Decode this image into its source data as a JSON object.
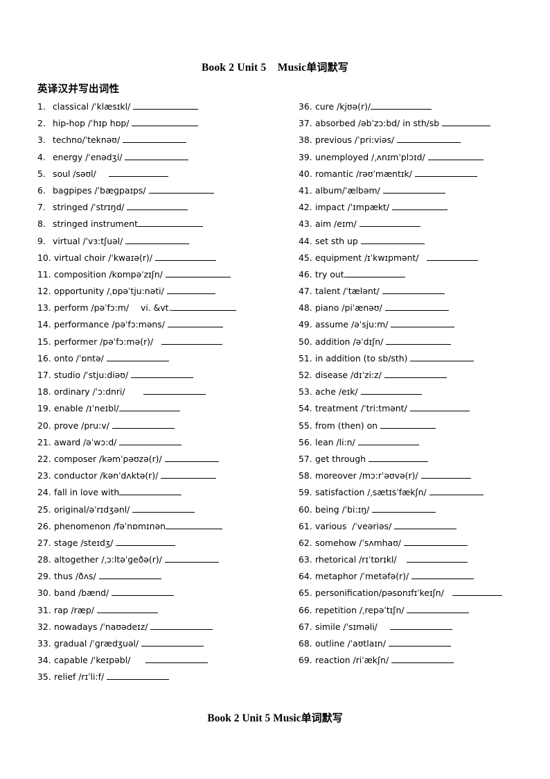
{
  "document": {
    "title_en": "Book 2 Unit 5    Music",
    "title_cn": "单词默写",
    "section_heading": "英译汉并写出词性",
    "footer_en": "Book 2 Unit 5 Music",
    "footer_cn": "单词默写"
  },
  "columns": {
    "left": [
      {
        "num": "1.",
        "term": "classical /ˈklæsɪkl/ ",
        "gap": 0,
        "blank": 94
      },
      {
        "num": "2.",
        "term": "hip-hop /ˈhɪp hɒp/ ",
        "gap": 0,
        "blank": 96
      },
      {
        "num": "3.",
        "term": "techno/ˈteknəʊ/ ",
        "gap": 0,
        "blank": 92
      },
      {
        "num": "4.",
        "term": "energy /ˈenədʒi/ ",
        "gap": 0,
        "blank": 92
      },
      {
        "num": "5.",
        "term": "soul /səʊl/ ",
        "gap": 14,
        "blank": 86
      },
      {
        "num": "6.",
        "term": "bagpipes /ˈbæɡpaɪps/ ",
        "gap": 0,
        "blank": 94
      },
      {
        "num": "7.",
        "term": "stringed /ˈstrɪŋd/ ",
        "gap": 0,
        "blank": 88
      },
      {
        "num": "8.",
        "term": "stringed instrument",
        "gap": 0,
        "blank": 94
      },
      {
        "num": "9.",
        "term": "virtual /ˈvɜ:tʃuəl/ ",
        "gap": 0,
        "blank": 92
      },
      {
        "num": "10.",
        "term": "virtual choir /ˈkwaɪə(r)/ ",
        "gap": 0,
        "blank": 88
      },
      {
        "num": "11.",
        "term": "composition /kɒmpəˈzɪʃn/ ",
        "gap": 0,
        "blank": 94
      },
      {
        "num": "12.",
        "term": "opportunity /ˌɒpəˈtju:nəti/ ",
        "gap": 0,
        "blank": 70
      },
      {
        "num": "13.",
        "term": "perform /pəˈfɔ:m/ ",
        "gap": 13,
        "blank": 0,
        "tail": "vi. &vt.",
        "tail_blank": 94
      },
      {
        "num": "14.",
        "term": "performance /pəˈfɔ:məns/ ",
        "gap": 0,
        "blank": 80
      },
      {
        "num": "15.",
        "term": "performer /pəˈfɔ:mə(r)/ ",
        "gap": 8,
        "blank": 88
      },
      {
        "num": "16.",
        "term": "onto /ˈɒntə/ ",
        "gap": 0,
        "blank": 90
      },
      {
        "num": "17.",
        "term": "studio /ˈstju:diəʊ/ ",
        "gap": 0,
        "blank": 90
      },
      {
        "num": "18.",
        "term": "ordinary /ˈɔ:dnri/ ",
        "gap": 22,
        "blank": 90
      },
      {
        "num": "19.",
        "term": "enable /ɪˈneɪbl/",
        "gap": 0,
        "blank": 88
      },
      {
        "num": "20.",
        "term": "prove /pru:v/ ",
        "gap": 0,
        "blank": 90
      },
      {
        "num": "21.",
        "term": "award /əˈwɔ:d/ ",
        "gap": 0,
        "blank": 90
      },
      {
        "num": "22.",
        "term": "composer /kəmˈpəʊzə(r)/ ",
        "gap": 0,
        "blank": 78
      },
      {
        "num": "23.",
        "term": "conductor /kənˈdʌktə(r)/ ",
        "gap": 0,
        "blank": 80
      },
      {
        "num": "24.",
        "term": "fall in love with",
        "gap": 0,
        "blank": 90
      },
      {
        "num": "25.",
        "term": "original/əˈrɪdʒənl/ ",
        "gap": 0,
        "blank": 90
      },
      {
        "num": "26.",
        "term": "phenomenon /fəˈnɒmɪnən",
        "gap": 0,
        "blank": 82
      },
      {
        "num": "27.",
        "term": "stage /steɪdʒ/ ",
        "gap": 0,
        "blank": 86
      },
      {
        "num": "28.",
        "term": "altogether /ˌɔ:ltəˈɡeðə(r)/ ",
        "gap": 0,
        "blank": 78
      },
      {
        "num": "29.",
        "term": "thus /ðʌs/ ",
        "gap": 0,
        "blank": 90
      },
      {
        "num": "30.",
        "term": "band /bænd/ ",
        "gap": 0,
        "blank": 90
      },
      {
        "num": "31.",
        "term": "rap /ræp/ ",
        "gap": 0,
        "blank": 88
      },
      {
        "num": "32.",
        "term": "nowadays /ˈnaʊədeɪz/ ",
        "gap": 0,
        "blank": 90
      },
      {
        "num": "33.",
        "term": "gradual /ˈɡrædʒuəl/ ",
        "gap": 0,
        "blank": 90
      },
      {
        "num": "34.",
        "term": "capable /ˈkeɪpəbl/ ",
        "gap": 18,
        "blank": 90
      },
      {
        "num": "35.",
        "term": "relief /rɪˈli:f/ ",
        "gap": 0,
        "blank": 90
      }
    ],
    "right": [
      {
        "num": "36.",
        "term": "cure /kjʊə(r)/",
        "gap": 0,
        "blank": 88
      },
      {
        "num": "37.",
        "term": "absorbed /əbˈzɔ:bd/ in sth/sb ",
        "gap": 0,
        "blank": 70
      },
      {
        "num": "38.",
        "term": "previous /ˈpri:viəs/ ",
        "gap": 0,
        "blank": 92
      },
      {
        "num": "39.",
        "term": "unemployed /ˌʌnɪmˈplɔɪd/ ",
        "gap": 0,
        "blank": 80
      },
      {
        "num": "40.",
        "term": "romantic /rəʊˈmæntɪk/ ",
        "gap": 0,
        "blank": 90
      },
      {
        "num": "41.",
        "term": "album/ˈælbəm/ ",
        "gap": 0,
        "blank": 90
      },
      {
        "num": "42.",
        "term": "impact /ˈɪmpækt/ ",
        "gap": 0,
        "blank": 80
      },
      {
        "num": "43.",
        "term": "aim /eɪm/ ",
        "gap": 0,
        "blank": 88
      },
      {
        "num": "44.",
        "term": "set sth up ",
        "gap": 0,
        "blank": 92
      },
      {
        "num": "45.",
        "term": "equipment /ɪˈkwɪpmənt/ ",
        "gap": 8,
        "blank": 74
      },
      {
        "num": "46.",
        "term": "try out",
        "gap": 0,
        "blank": 88
      },
      {
        "num": "47.",
        "term": "talent /ˈtælənt/ ",
        "gap": 0,
        "blank": 90
      },
      {
        "num": "48.",
        "term": "piano /piˈænəʊ/ ",
        "gap": 0,
        "blank": 92
      },
      {
        "num": "49.",
        "term": "assume /əˈsju:m/ ",
        "gap": 0,
        "blank": 92
      },
      {
        "num": "50.",
        "term": "addition /əˈdɪʃn/ ",
        "gap": 0,
        "blank": 94
      },
      {
        "num": "51.",
        "term": "in addition (to sb/sth) ",
        "gap": 0,
        "blank": 92
      },
      {
        "num": "52.",
        "term": "disease /dɪˈzi:z/ ",
        "gap": 0,
        "blank": 90
      },
      {
        "num": "53.",
        "term": "ache /eɪk/ ",
        "gap": 0,
        "blank": 88
      },
      {
        "num": "54.",
        "term": "treatment /ˈtri:tmənt/ ",
        "gap": 0,
        "blank": 86
      },
      {
        "num": "55.",
        "term": "from (then) on ",
        "gap": 0,
        "blank": 80
      },
      {
        "num": "56.",
        "term": "lean /li:n/ ",
        "gap": 0,
        "blank": 88
      },
      {
        "num": "57.",
        "term": "get through ",
        "gap": 0,
        "blank": 86
      },
      {
        "num": "58.",
        "term": "moreover /mɔ:rˈəʊvə(r)/ ",
        "gap": 0,
        "blank": 72
      },
      {
        "num": "59.",
        "term": "satisfaction /ˌsætɪsˈfækʃn/ ",
        "gap": 0,
        "blank": 78
      },
      {
        "num": "60.",
        "term": "being /ˈbi:ɪŋ/ ",
        "gap": 0,
        "blank": 92
      },
      {
        "num": "61.",
        "term": "various  /ˈveəriəs/ ",
        "gap": 0,
        "blank": 90
      },
      {
        "num": "62.",
        "term": "somehow /ˈsʌmhaʊ/ ",
        "gap": 0,
        "blank": 92
      },
      {
        "num": "63.",
        "term": "rhetorical /rɪˈtɒrɪkl/ ",
        "gap": 10,
        "blank": 88
      },
      {
        "num": "64.",
        "term": "metaphor /ˈmetəfə(r)/ ",
        "gap": 0,
        "blank": 90
      },
      {
        "num": "65.",
        "term": "personification/pəsɒnɪfɪˈkeɪʃn/ ",
        "gap": 8,
        "blank": 72
      },
      {
        "num": "66.",
        "term": "repetition /ˌrepəˈtɪʃn/ ",
        "gap": 0,
        "blank": 90
      },
      {
        "num": "67.",
        "term": "simile /ˈsɪməli/ ",
        "gap": 14,
        "blank": 90
      },
      {
        "num": "68.",
        "term": "outline /ˈaʊtlaɪn/ ",
        "gap": 0,
        "blank": 90
      },
      {
        "num": "69.",
        "term": "reaction /riˈækʃn/ ",
        "gap": 0,
        "blank": 90
      }
    ]
  }
}
